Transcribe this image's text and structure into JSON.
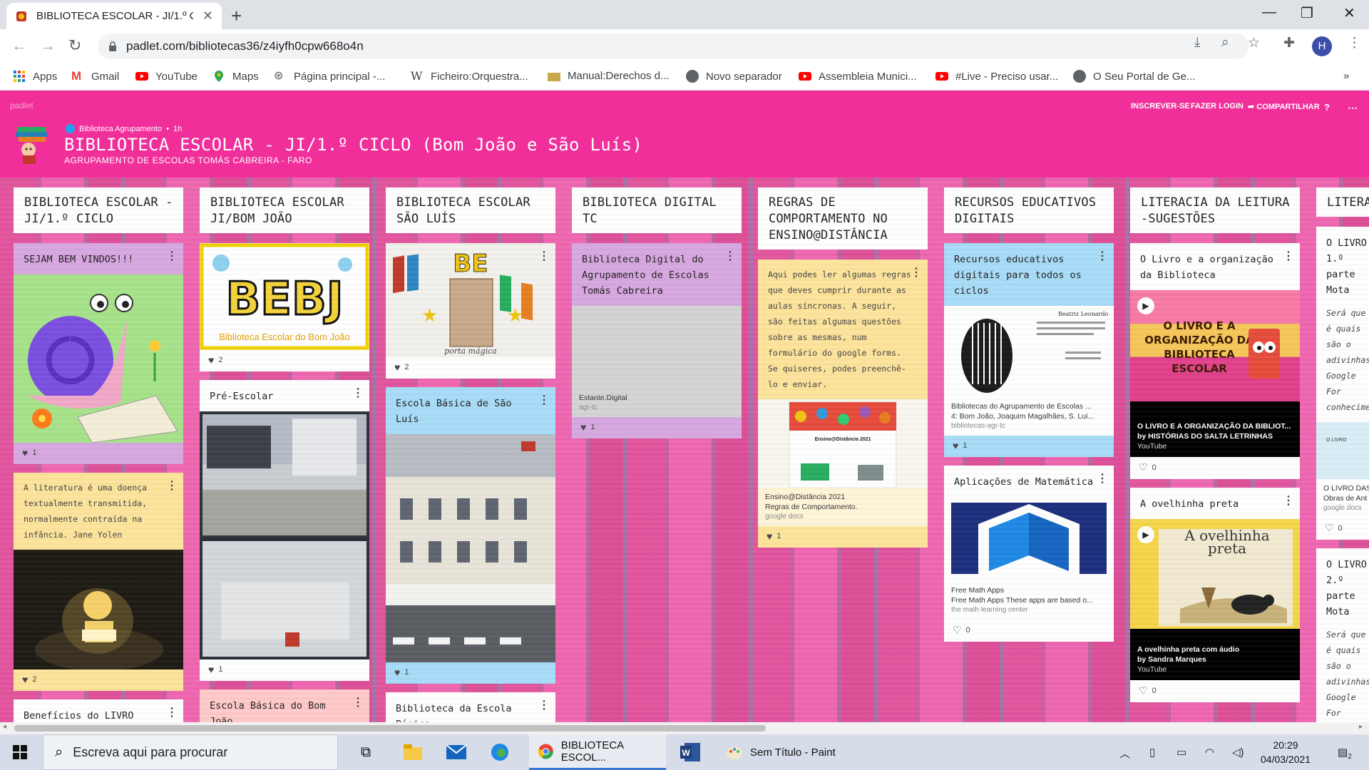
{
  "browser": {
    "tab_title": "BIBLIOTECA ESCOLAR - JI/1.º CICLO",
    "url": "padlet.com/bibliotecas36/z4iyfh0cpw668o4n",
    "profile_initial": "H",
    "bookmarks": [
      "Apps",
      "Gmail",
      "YouTube",
      "Maps",
      "Página principal -...",
      "Ficheiro:Orquestra...",
      "Manual:Derechos d...",
      "Novo separador",
      "Assembleia Munici...",
      "#Live - Preciso usar...",
      "O Seu Portal de Ge..."
    ]
  },
  "padlet": {
    "brand": "padlet",
    "actions": [
      "INSCREVER-SE",
      "FAZER LOGIN",
      "COMPARTILHAR"
    ],
    "author": "Biblioteca Agrupamento",
    "time": "1h",
    "title": "BIBLIOTECA ESCOLAR - JI/1.º CICLO (Bom João e São Luís)",
    "subtitle": "AGRUPAMENTO DE ESCOLAS TOMÁS CABREIRA - FARO",
    "accent": "#f02f9b"
  },
  "columns": [
    {
      "title": "BIBLIOTECA ESCOLAR - JI/1.º CICLO",
      "cards": [
        {
          "title": "SEJAM BEM VINDOS!!!",
          "likes": "1",
          "color": "#d8a7e0"
        },
        {
          "body": "A literatura é uma doença textualmente transmitida, normalmente contraída na infância. Jane Yolen",
          "likes": "2",
          "color": "#fde49c"
        },
        {
          "title": "Benefícios do LIVRO",
          "color": "#ffffff"
        }
      ]
    },
    {
      "title": "BIBLIOTECA ESCOLAR JI/BOM JOÃO",
      "cards": [
        {
          "image_text": "BEBJ",
          "image_caption": "Biblioteca Escolar do Bom João",
          "likes": "2",
          "color": "#ffffff"
        },
        {
          "title": "Pré-Escolar",
          "likes": "1",
          "color": "#ffffff"
        },
        {
          "title": "Escola Básica do Bom João",
          "color": "#ffc9c9"
        }
      ]
    },
    {
      "title": "BIBLIOTECA ESCOLAR SÃO LUÍS",
      "cards": [
        {
          "image_text": "BE",
          "image_caption": "porta mágica",
          "likes": "2",
          "color": "#ffffff"
        },
        {
          "title": "Escola Básica de São Luís",
          "likes": "1",
          "color": "#a8dcf8"
        },
        {
          "title": "Biblioteca da Escola Básica",
          "color": "#ffffff"
        }
      ]
    },
    {
      "title": "BIBLIOTECA DIGITAL TC",
      "cards": [
        {
          "title": "Biblioteca Digital do Agrupamento de Escolas Tomás Cabreira",
          "link_title": "Estante.Digital",
          "link_src": "agr-tc",
          "likes": "1",
          "color": "#d8a7e0"
        }
      ]
    },
    {
      "title": "REGRAS DE COMPORTAMENTO NO ENSINO@DISTÂNCIA",
      "cards": [
        {
          "body": "Aqui podes ler algumas regras que deves cumprir durante as aulas síncronas. A seguir, são feitas algumas questões sobre as mesmas, num formulário do google forms. Se quiseres, podes preenchê-lo e enviar.",
          "link_title": "Ensino@Distância 2021",
          "link_desc": "Regras de Comportamento.",
          "link_src": "google docs",
          "doc_heading": "Ensino@Distância 2021",
          "likes": "1",
          "color": "#fde49c"
        }
      ]
    },
    {
      "title": "RECURSOS EDUCATIVOS DIGITAIS",
      "cards": [
        {
          "title": "Recursos educativos digitais para todos os ciclos",
          "link_title": "Bibliotecas do Agrupamento de Escolas ...",
          "link_desc": "4: Bom João, Joaquim Magalhães, S. Lui...",
          "link_src": "bibliotecas-agr-tc",
          "image_caption": "Beatriz Leonardo",
          "likes": "1",
          "color": "#a8dcf8"
        },
        {
          "title": "Aplicações de Matemática",
          "link_title": "Free Math Apps",
          "link_desc": "Free Math Apps These apps are based o...",
          "link_src": "the math learning center",
          "likes": "0",
          "color": "#ffffff"
        }
      ]
    },
    {
      "title": "LITERACIA DA LEITURA -SUGESTÕES",
      "cards": [
        {
          "title": "O Livro e a organização da Biblioteca",
          "image_text": "O LIVRO E A ORGANIZAÇÃO DA BIBLIOTECA ESCOLAR",
          "video_title": "O LIVRO E A ORGANIZAÇÃO DA BIBLIOT...",
          "video_by": "by HISTÓRIAS DO SALTA LETRINHAS",
          "video_src": "YouTube",
          "likes": "0",
          "color": "#ffffff"
        },
        {
          "title": "A ovelhinha preta",
          "image_text": "A ovelhinha preta",
          "video_title": "A ovelhinha preta com áudio",
          "video_by": "by Sandra Marques",
          "video_src": "YouTube",
          "likes": "0",
          "color": "#ffffff"
        }
      ]
    },
    {
      "title": "LITERA",
      "cards": [
        {
          "title": "O LIVRO 1.º parte Mota",
          "body": "Será que é quais são o adivinhas Google For conhecime",
          "link_title": "O LIVRO DAS",
          "link_desc": "Obras de Ant",
          "link_src": "google docs",
          "image_text": "O LIVRO",
          "likes": "0",
          "color": "#ffffff"
        },
        {
          "title": "O LIVRO 2.º parte Mota",
          "body": "Será que é quais são o adivinhas Google For conhecime",
          "color": "#ffffff"
        }
      ]
    }
  ],
  "taskbar": {
    "search_placeholder": "Escreva aqui para procurar",
    "apps": [
      "BIBLIOTECA ESCOL...",
      "Sem Título - Paint"
    ],
    "time": "20:29",
    "date": "04/03/2021",
    "notifications": "2"
  }
}
